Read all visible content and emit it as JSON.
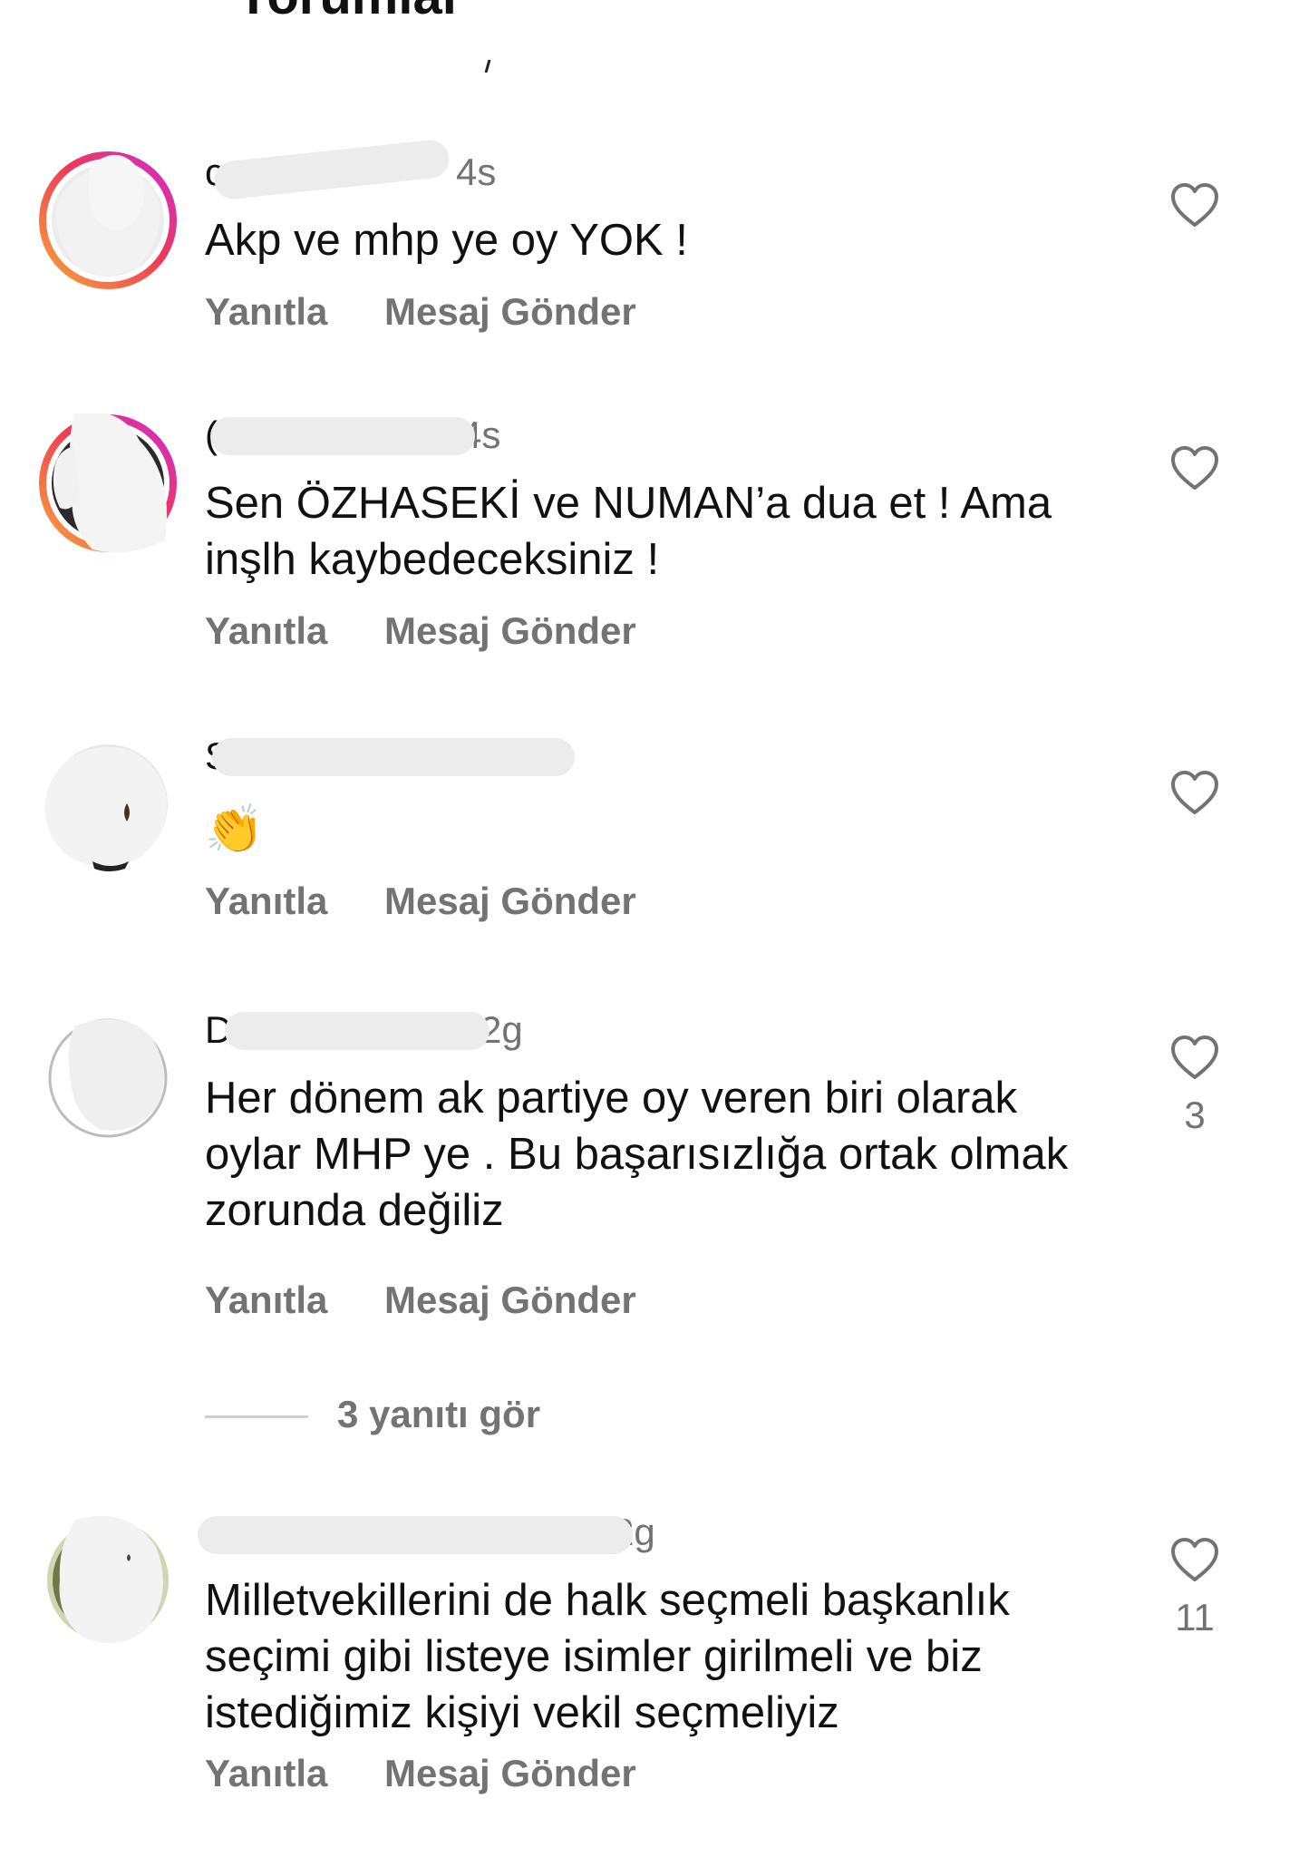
{
  "header": {
    "title": "Yorumlar"
  },
  "colors": {
    "text": "#111111",
    "muted": "#737373",
    "story_ring_start": "#f9a43a",
    "story_ring_end": "#d22ad0"
  },
  "comments": [
    {
      "username_visible": "c",
      "time": "4s",
      "text": "Akp ve mhp ye oy YOK !",
      "reply": "Yanıtla",
      "send_message": "Mesaj Gönder",
      "like_count": ""
    },
    {
      "username_visible": "(",
      "time": "4s",
      "text": "Sen ÖZHASEKİ ve NUMAN’a dua et ! Ama inşlh kaybedeceksiniz !",
      "reply": "Yanıtla",
      "send_message": "Mesaj Gönder",
      "like_count": ""
    },
    {
      "username_visible": "S",
      "time": "",
      "text": "👏",
      "reply": "Yanıtla",
      "send_message": "Mesaj Gönder",
      "like_count": ""
    },
    {
      "username_visible": "D",
      "time": "2g",
      "text": "Her dönem ak partiye oy veren biri olarak oylar MHP ye . Bu başarısızlığa ortak olmak zorunda değiliz",
      "reply": "Yanıtla",
      "send_message": "Mesaj Gönder",
      "like_count": "3",
      "view_replies": "3 yanıtı gör"
    },
    {
      "username_visible": "",
      "time": "2g",
      "text": "Milletvekillerini de halk seçmeli başkanlık seçimi gibi listeye isimler girilmeli ve biz istediğimiz kişiyi vekil seçmeliyiz",
      "reply": "Yanıtla",
      "send_message": "Mesaj Gönder",
      "like_count": "11"
    }
  ]
}
